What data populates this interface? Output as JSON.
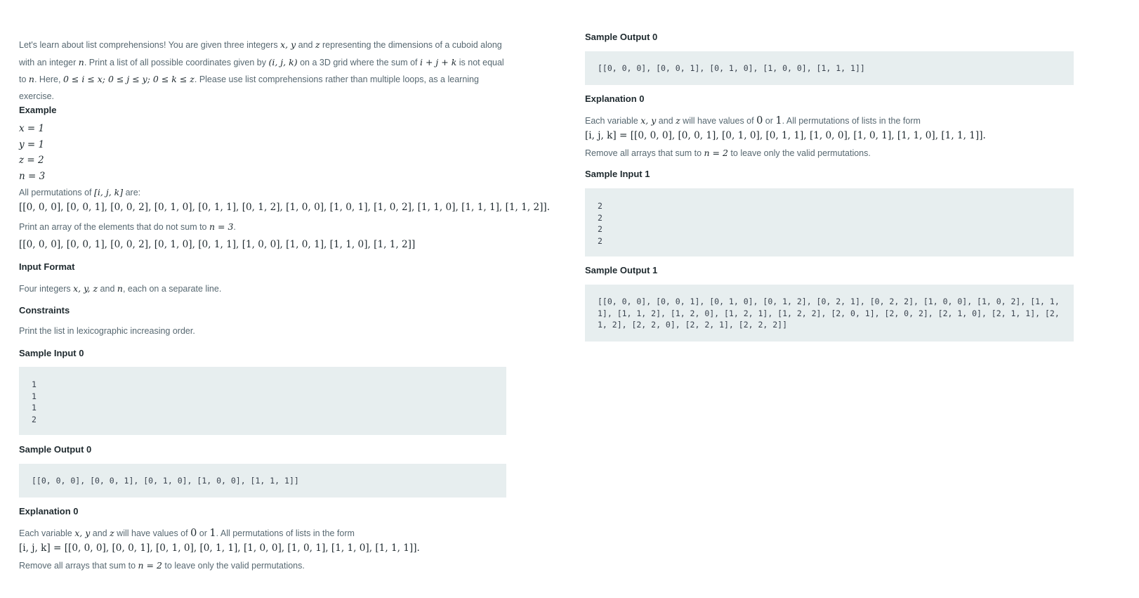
{
  "left": {
    "intro": {
      "l1a": "Let's learn about list comprehensions! You are given three integers ",
      "l1m": "x, y",
      "l1b": " and ",
      "l1m2": "z",
      "l1c": " representing the dimensions of a cuboid along",
      "l2a": "with an integer ",
      "l2m": "n",
      "l2b": ". Print a list of all possible coordinates given by ",
      "l2m2": "(i, j, k)",
      "l2c": " on a 3D grid where the sum of ",
      "l2m3": "i + j + k",
      "l2d": " is not equal",
      "l3a": "to ",
      "l3m": "n",
      "l3b": ". Here, ",
      "l3m2": "0 ≤ i ≤ x; 0 ≤ j ≤ y; 0 ≤ k ≤ z",
      "l3c": ". Please use list comprehensions rather than multiple loops, as a learning",
      "l4": "exercise."
    },
    "example_heading": "Example",
    "example_values": [
      "x = 1",
      "y = 1",
      "z = 2",
      "n = 3"
    ],
    "perm_text_a": "All permutations of ",
    "perm_text_m": "[i, j, k]",
    "perm_text_b": " are:",
    "perm_list": "[[0, 0, 0], [0, 0, 1], [0, 0, 2], [0, 1, 0], [0, 1, 1], [0, 1, 2], [1, 0, 0], [1, 0, 1], [1, 0, 2], [1, 1, 0], [1, 1, 1], [1, 1, 2]].",
    "print_text_a": "Print an array of the elements that do not sum to ",
    "print_text_m": "n = 3",
    "print_text_b": ".",
    "result_list": "[[0, 0, 0], [0, 0, 1], [0, 0, 2], [0, 1, 0], [0, 1, 1], [1, 0, 0], [1, 0, 1], [1, 1, 0], [1, 1, 2]]",
    "input_format_heading": "Input Format",
    "input_format_a": "Four integers ",
    "input_format_m": "x, y, z",
    "input_format_b": " and ",
    "input_format_m2": "n",
    "input_format_c": ", each on a separate line.",
    "constraints_heading": "Constraints",
    "constraints_text": "Print the list in lexicographic increasing order.",
    "sample_input0_heading": "Sample Input 0",
    "sample_input0": "1\n1\n1\n2",
    "sample_output0_heading": "Sample Output 0",
    "sample_output0": "[[0, 0, 0], [0, 0, 1], [0, 1, 0], [1, 0, 0], [1, 1, 1]]",
    "explanation0_heading": "Explanation 0",
    "expl_a": "Each variable ",
    "expl_m": "x, y",
    "expl_b": " and ",
    "expl_m2": "z",
    "expl_c": " will have values of ",
    "expl_m3": "0",
    "expl_d": " or ",
    "expl_m4": "1",
    "expl_e": ". All permutations of lists in the form",
    "expl_list": "[i, j, k] = [[0, 0, 0], [0, 0, 1], [0, 1, 0], [0, 1, 1], [1, 0, 0], [1, 0, 1], [1, 1, 0], [1, 1, 1]].",
    "expl_remove_a": "Remove all arrays that sum to ",
    "expl_remove_m": "n = 2",
    "expl_remove_b": " to leave only the valid permutations."
  },
  "right": {
    "sample_output0_heading": "Sample Output 0",
    "sample_output0": "[[0, 0, 0], [0, 0, 1], [0, 1, 0], [1, 0, 0], [1, 1, 1]]",
    "explanation0_heading": "Explanation 0",
    "expl_a": "Each variable ",
    "expl_m": "x, y",
    "expl_b": " and ",
    "expl_m2": "z",
    "expl_c": " will have values of ",
    "expl_m3": "0",
    "expl_d": " or ",
    "expl_m4": "1",
    "expl_e": ". All permutations of lists in the form",
    "expl_list": "[i, j, k] = [[0, 0, 0], [0, 0, 1], [0, 1, 0], [0, 1, 1], [1, 0, 0], [1, 0, 1], [1, 1, 0], [1, 1, 1]].",
    "expl_remove_a": "Remove all arrays that sum to ",
    "expl_remove_m": "n = 2",
    "expl_remove_b": " to leave only the valid permutations.",
    "sample_input1_heading": "Sample Input 1",
    "sample_input1": "2\n2\n2\n2",
    "sample_output1_heading": "Sample Output 1",
    "sample_output1": "[[0, 0, 0], [0, 0, 1], [0, 1, 0], [0, 1, 2], [0, 2, 1], [0, 2, 2], [1, 0, 0], [1, 0, 2], [1, 1, 1], [1, 1, 2], [1, 2, 0], [1, 2, 1], [1, 2, 2], [2, 0, 1], [2, 0, 2], [2, 1, 0], [2, 1, 1], [2, 1, 2], [2, 2, 0], [2, 2, 1], [2, 2, 2]]"
  }
}
